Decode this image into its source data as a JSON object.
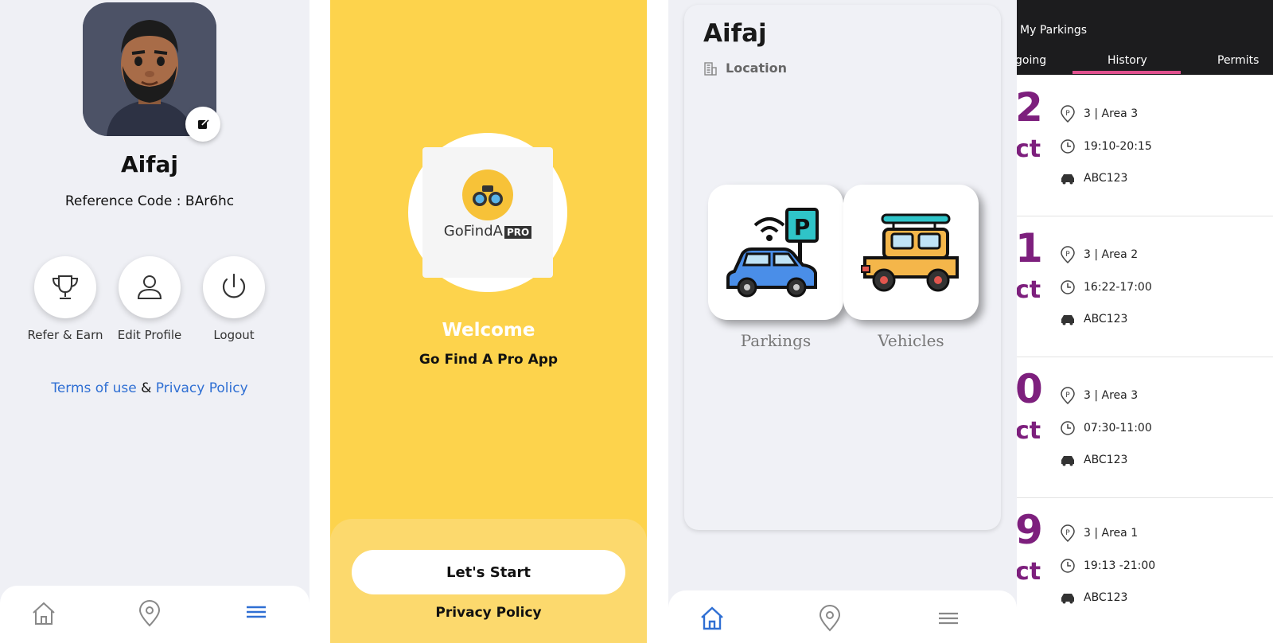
{
  "profile": {
    "name": "Aifaj",
    "reference_code": "Reference Code : BAr6hc",
    "actions": [
      {
        "label": "Refer & Earn",
        "icon": "trophy-icon"
      },
      {
        "label": "Edit Profile",
        "icon": "user-icon"
      },
      {
        "label": "Logout",
        "icon": "power-icon"
      }
    ],
    "terms_label": "Terms of use",
    "amp": "&",
    "privacy_label": "Privacy Policy",
    "active_nav": "menu",
    "link_color": "#2f6fd3"
  },
  "welcome": {
    "logo_text": "GoFindA",
    "logo_badge": "PRO",
    "title": "Welcome",
    "subtitle": "Go Find A Pro App",
    "start_button": "Let's Start",
    "privacy_link": "Privacy Policy",
    "bg_color": "#fdd34c"
  },
  "home": {
    "name": "Aifaj",
    "location_label": "Location",
    "tiles": [
      {
        "label": "Parkings",
        "icon": "parking-car-icon"
      },
      {
        "label": "Vehicles",
        "icon": "jeep-icon"
      }
    ],
    "active_nav": "home"
  },
  "parkings": {
    "title": "My Parkings",
    "tabs": [
      "going",
      "History",
      "Permits"
    ],
    "active_tab": "History",
    "accent_color": "#e0508e",
    "date_color": "#7d1f7d",
    "rows": [
      {
        "day": "2",
        "month": "ct",
        "area": "3 | Area 3",
        "time": "19:10-20:15",
        "plate": "ABC123"
      },
      {
        "day": "1",
        "month": "ct",
        "area": "3 | Area 2",
        "time": "16:22-17:00",
        "plate": "ABC123"
      },
      {
        "day": "0",
        "month": "ct",
        "area": "3 | Area 3",
        "time": "07:30-11:00",
        "plate": "ABC123"
      },
      {
        "day": "9",
        "month": "ct",
        "area": "3 | Area 1",
        "time": "19:13 -21:00",
        "plate": "ABC123"
      }
    ]
  }
}
